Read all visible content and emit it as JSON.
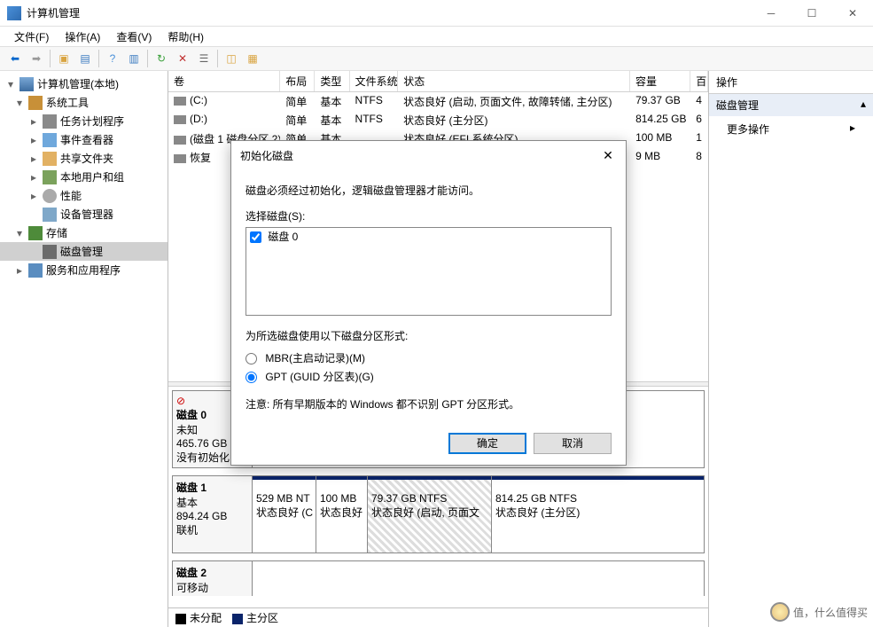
{
  "titlebar": {
    "title": "计算机管理"
  },
  "menubar": {
    "file": "文件(F)",
    "action": "操作(A)",
    "view": "查看(V)",
    "help": "帮助(H)"
  },
  "tree": {
    "root": "计算机管理(本地)",
    "system_tools": "系统工具",
    "task_scheduler": "任务计划程序",
    "event_viewer": "事件查看器",
    "shared_folders": "共享文件夹",
    "local_users": "本地用户和组",
    "performance": "性能",
    "device_manager": "设备管理器",
    "storage": "存储",
    "disk_mgmt": "磁盘管理",
    "services": "服务和应用程序"
  },
  "vol_header": {
    "volume": "卷",
    "layout": "布局",
    "type": "类型",
    "fs": "文件系统",
    "status": "状态",
    "capacity": "容量",
    "last": "百"
  },
  "volumes": [
    {
      "name": "(C:)",
      "layout": "简单",
      "type": "基本",
      "fs": "NTFS",
      "status": "状态良好 (启动, 页面文件, 故障转储, 主分区)",
      "capacity": "79.37 GB",
      "last": "4"
    },
    {
      "name": "(D:)",
      "layout": "简单",
      "type": "基本",
      "fs": "NTFS",
      "status": "状态良好 (主分区)",
      "capacity": "814.25 GB",
      "last": "6"
    },
    {
      "name": "(磁盘 1 磁盘分区 2)",
      "layout": "简单",
      "type": "基本",
      "fs": "",
      "status": "状态良好 (EFI 系统分区)",
      "capacity": "100 MB",
      "last": "1"
    },
    {
      "name": "恢复",
      "layout": "",
      "type": "",
      "fs": "",
      "status": "",
      "capacity": "9 MB",
      "last": "8"
    }
  ],
  "disk0": {
    "name": "磁盘 0",
    "status": "未知",
    "size": "465.76 GB",
    "init": "没有初始化"
  },
  "disk1": {
    "name": "磁盘 1",
    "type": "基本",
    "size": "894.24 GB",
    "status": "联机",
    "p1": {
      "size": "529 MB NT",
      "status": "状态良好 (C"
    },
    "p2": {
      "size": "100 MB",
      "status": "状态良好"
    },
    "p3": {
      "size": "79.37 GB NTFS",
      "status": "状态良好 (启动, 页面文"
    },
    "p4": {
      "size": "814.25 GB NTFS",
      "status": "状态良好 (主分区)"
    }
  },
  "disk2": {
    "name": "磁盘 2",
    "status": "可移动"
  },
  "legend": {
    "unalloc": "未分配",
    "primary": "主分区"
  },
  "actions": {
    "header": "操作",
    "section": "磁盘管理",
    "more": "更多操作"
  },
  "dialog": {
    "title": "初始化磁盘",
    "message": "磁盘必须经过初始化，逻辑磁盘管理器才能访问。",
    "select_label": "选择磁盘(S):",
    "disk_item": "磁盘 0",
    "style_label": "为所选磁盘使用以下磁盘分区形式:",
    "mbr": "MBR(主启动记录)(M)",
    "gpt": "GPT (GUID 分区表)(G)",
    "note": "注意: 所有早期版本的 Windows 都不识别 GPT 分区形式。",
    "ok": "确定",
    "cancel": "取消"
  },
  "watermark": "值，什么值得买"
}
